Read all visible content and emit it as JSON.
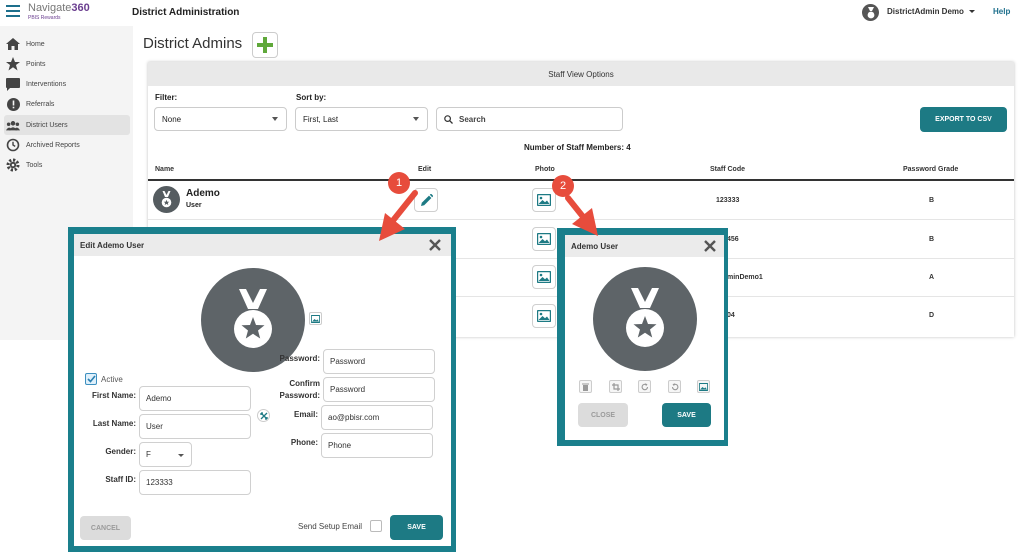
{
  "topbar": {
    "brand_name": "Navigate",
    "brand_num": "360",
    "brand_sub": "PBIS Rewards",
    "page_heading": "District Administration",
    "user_name": "DistrictAdmin Demo",
    "help": "Help"
  },
  "sidebar": {
    "items": [
      {
        "label": "Home",
        "icon": "home-icon"
      },
      {
        "label": "Points",
        "icon": "star-icon"
      },
      {
        "label": "Interventions",
        "icon": "chat-icon"
      },
      {
        "label": "Referrals",
        "icon": "alert-icon"
      },
      {
        "label": "District Users",
        "icon": "users-icon"
      },
      {
        "label": "Archived Reports",
        "icon": "history-icon"
      },
      {
        "label": "Tools",
        "icon": "gear-icon"
      }
    ]
  },
  "main": {
    "title": "District Admins",
    "view_options_title": "Staff View Options",
    "filter_label": "Filter:",
    "filter_value": "None",
    "sort_label": "Sort by:",
    "sort_value": "First, Last",
    "search_placeholder": "Search",
    "export_label": "EXPORT TO CSV",
    "staff_count": "Number of Staff Members: 4",
    "columns": [
      "Name",
      "Edit",
      "Photo",
      "Staff Code",
      "Password Grade"
    ],
    "rows": [
      {
        "name": "Ademo",
        "role": "User",
        "staff_code": "123333",
        "grade": "B"
      },
      {
        "name": "",
        "role": "",
        "staff_code": "456",
        "grade": "B"
      },
      {
        "name": "",
        "role": "",
        "staff_code": "minDemo1",
        "grade": "A"
      },
      {
        "name": "",
        "role": "",
        "staff_code": "04",
        "grade": "D"
      }
    ]
  },
  "edit_modal": {
    "title": "Edit Ademo User",
    "active_label": "Active",
    "first_name_label": "First Name:",
    "first_name_value": "Ademo",
    "last_name_label": "Last Name:",
    "last_name_value": "User",
    "gender_label": "Gender:",
    "gender_value": "F",
    "staff_id_label": "Staff ID:",
    "staff_id_value": "123333",
    "password_label": "Password:",
    "password_placeholder": "Password",
    "confirm_label_1": "Confirm",
    "confirm_label_2": "Password:",
    "confirm_placeholder": "Password",
    "email_label": "Email:",
    "email_value": "ao@pbisr.com",
    "phone_label": "Phone:",
    "phone_placeholder": "Phone",
    "cancel_label": "CANCEL",
    "send_setup_label": "Send Setup Email",
    "save_label": "SAVE"
  },
  "photo_modal": {
    "title": "Ademo User",
    "close_label": "CLOSE",
    "save_label": "SAVE"
  },
  "annotations": {
    "marker_1": "1",
    "marker_2": "2"
  },
  "colors": {
    "teal": "#1d7a84",
    "frame_teal": "#1a7f8c",
    "add_green": "#5fa83a",
    "arrow_red": "#e74c3c"
  }
}
